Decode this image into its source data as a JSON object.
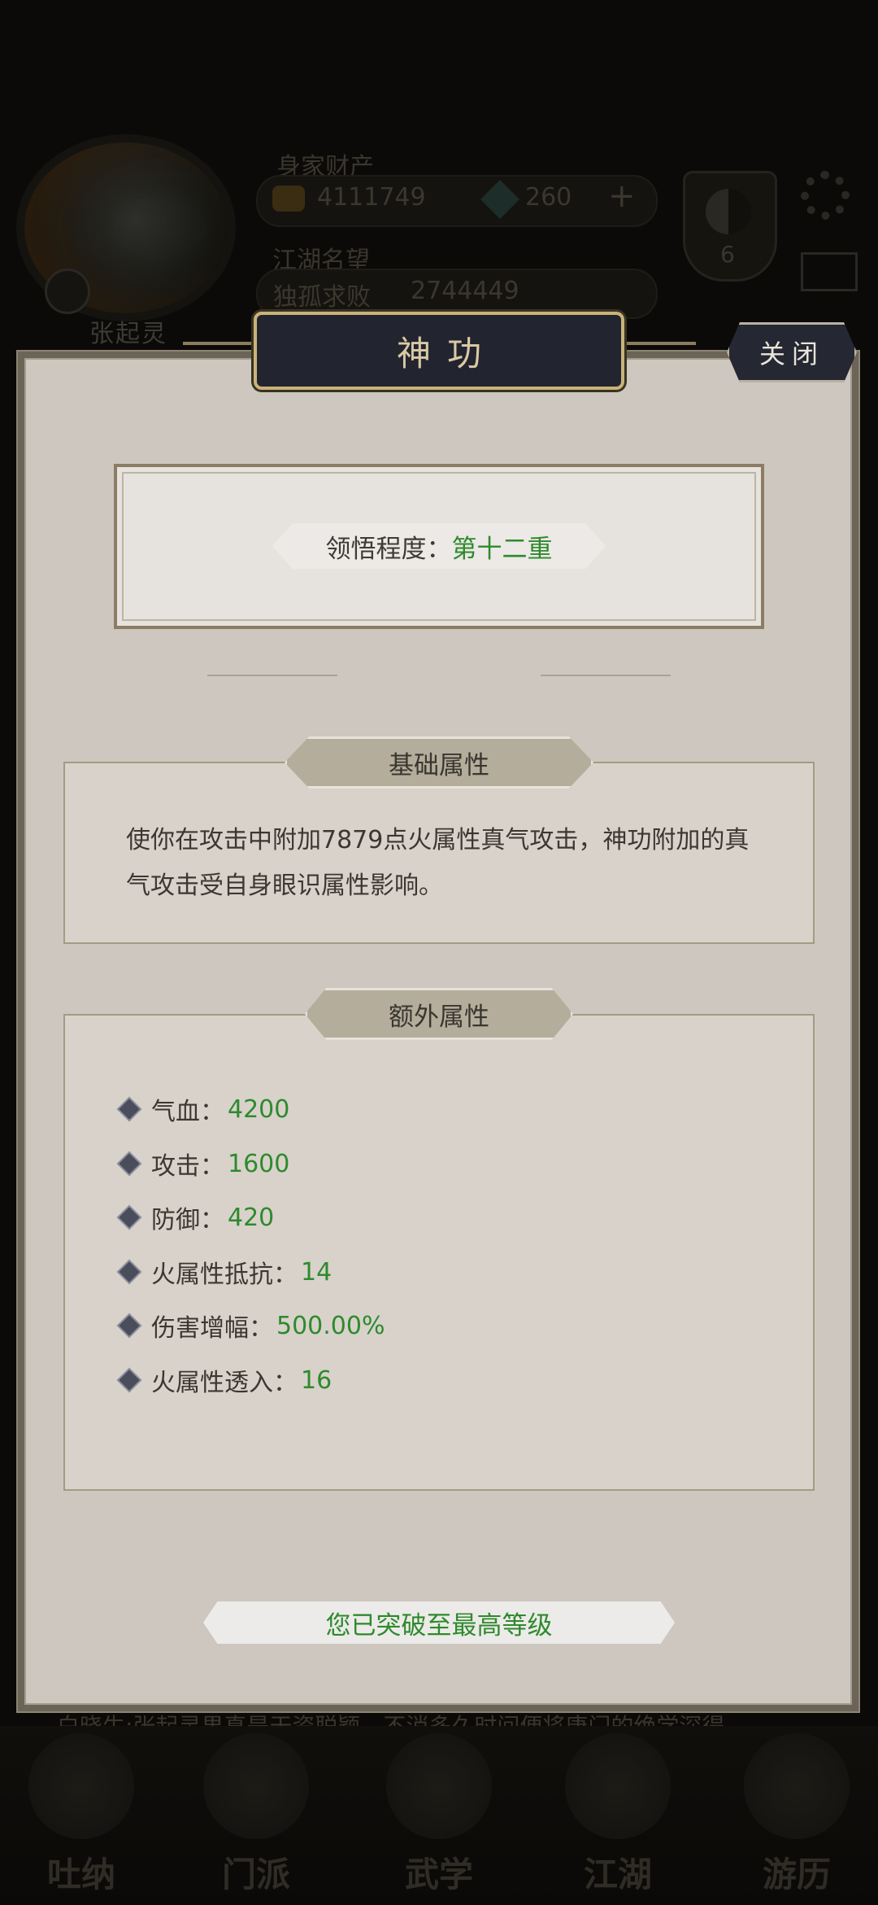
{
  "background": {
    "player_name": "张起灵",
    "assets_label": "身家财产",
    "gold_value": "4111749",
    "jade_value": "260",
    "plus_label": "+",
    "fame_label": "江湖名望",
    "fame_title": "独孤求败",
    "fame_value": "2744449",
    "taiji_count": "6",
    "ticker_text": "白晓生:张起灵果真是天资聪颖，不消多久时间便将唐门的绝学深得",
    "nav": [
      "吐纳",
      "门派",
      "武学",
      "江湖",
      "游历"
    ]
  },
  "modal": {
    "title": "神功",
    "close_label": "关闭",
    "mastery_label": "领悟程度：",
    "mastery_value": "第十二重",
    "base_section_title": "基础属性",
    "base_description": "使你在攻击中附加7879点火属性真气攻击，神功附加的真气攻击受自身眼识属性影响。",
    "extra_section_title": "额外属性",
    "stats": [
      {
        "label": "气血：",
        "value": "4200"
      },
      {
        "label": "攻击：",
        "value": "1600"
      },
      {
        "label": "防御：",
        "value": "420"
      },
      {
        "label": "火属性抵抗：",
        "value": "14"
      },
      {
        "label": "伤害增幅：",
        "value": "500.00%"
      },
      {
        "label": "火属性透入：",
        "value": "16"
      }
    ],
    "max_level_text": "您已突破至最高等级"
  },
  "colors": {
    "accent_green": "#2e8a2c",
    "title_plate": "#222430",
    "panel": "#cdc7bf"
  }
}
